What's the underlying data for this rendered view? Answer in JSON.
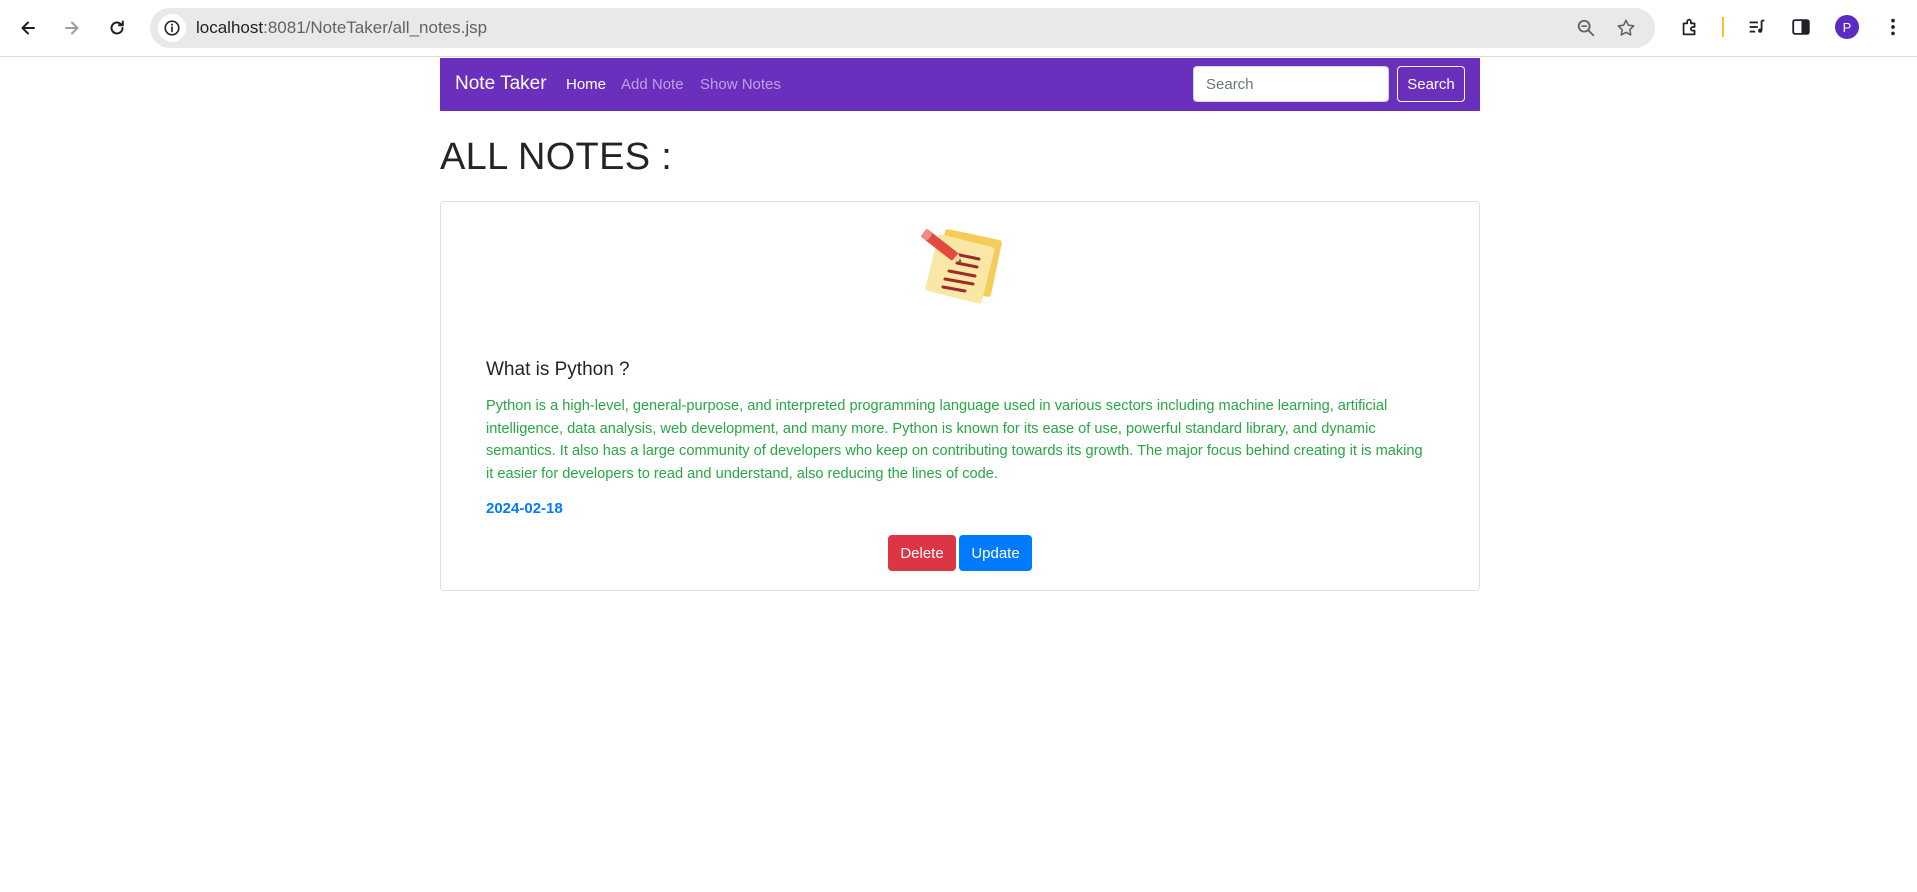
{
  "browser": {
    "url_host": "localhost",
    "url_path": ":8081/NoteTaker/all_notes.jsp",
    "profile_initial": "P"
  },
  "navbar": {
    "brand": "Note Taker",
    "links": [
      {
        "label": "Home"
      },
      {
        "label": "Add Note"
      },
      {
        "label": "Show Notes"
      }
    ],
    "search_placeholder": "Search",
    "search_button": "Search"
  },
  "page": {
    "heading": "ALL NOTES :"
  },
  "note": {
    "title": "What is Python ?",
    "content": "Python is a high-level, general-purpose, and interpreted programming language used in various sectors including machine learning, artificial intelligence, data analysis, web development, and many more. Python is known for its ease of use, powerful standard library, and dynamic semantics. It also has a large community of developers who keep on contributing towards its growth. The major focus behind creating it is making it easier for developers to read and understand, also reducing the lines of code.",
    "date": "2024-02-18",
    "delete_label": "Delete",
    "update_label": "Update"
  },
  "colors": {
    "navbar_bg": "#6a30bd",
    "content_text": "#28a745",
    "date_text": "#007bff",
    "delete_button": "#dc3545",
    "update_button": "#007bff"
  }
}
